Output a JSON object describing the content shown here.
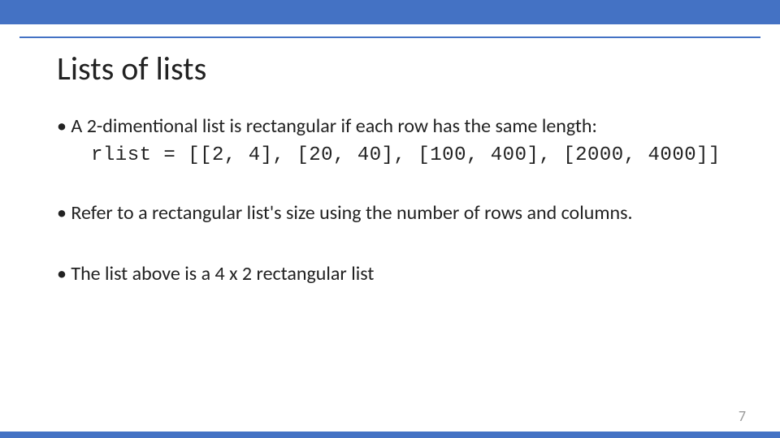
{
  "slide": {
    "title": "Lists of lists",
    "bullets": {
      "b1": "• A 2-dimentional list is rectangular if each row has the same length:",
      "code": "rlist = [[2, 4], [20, 40], [100, 400], [2000, 4000]]",
      "b2": "• Refer to a rectangular list's size using the number of rows and columns.",
      "b3": "• The list above is a 4 x 2 rectangular list"
    },
    "page_number": "7"
  }
}
